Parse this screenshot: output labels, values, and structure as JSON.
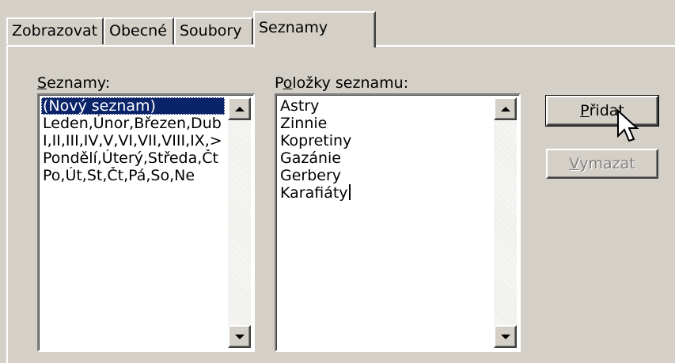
{
  "tabs": [
    {
      "label": "Zobrazovat",
      "active": false
    },
    {
      "label": "Obecné",
      "active": false
    },
    {
      "label": "Soubory",
      "active": false
    },
    {
      "label": "Seznamy",
      "active": true
    }
  ],
  "lists_label": {
    "accel": "S",
    "rest": "eznamy:"
  },
  "lists": [
    "(Nový seznam)",
    "Leden,Únor,Březen,Dub",
    "I,II,III,IV,V,VI,VII,VIII,IX,>",
    "Pondělí,Úterý,Středa,Čt",
    "Po,Út,St,Čt,Pá,So,Ne"
  ],
  "selected_list_index": 0,
  "items_label": {
    "before": "P",
    "accel": "o",
    "rest": "ložky seznamu:"
  },
  "list_entries": [
    "Astry",
    "Zinnie",
    "Kopretiny",
    "Gazánie",
    "Gerbery",
    "Karafiáty"
  ],
  "buttons": {
    "add": {
      "accel": "P",
      "rest": "řidat"
    },
    "delete": {
      "accel": "V",
      "rest": "ymazat"
    }
  },
  "colors": {
    "face": "#d4d0c8",
    "selection": "#0a246a",
    "disabled_text": "#808080"
  }
}
